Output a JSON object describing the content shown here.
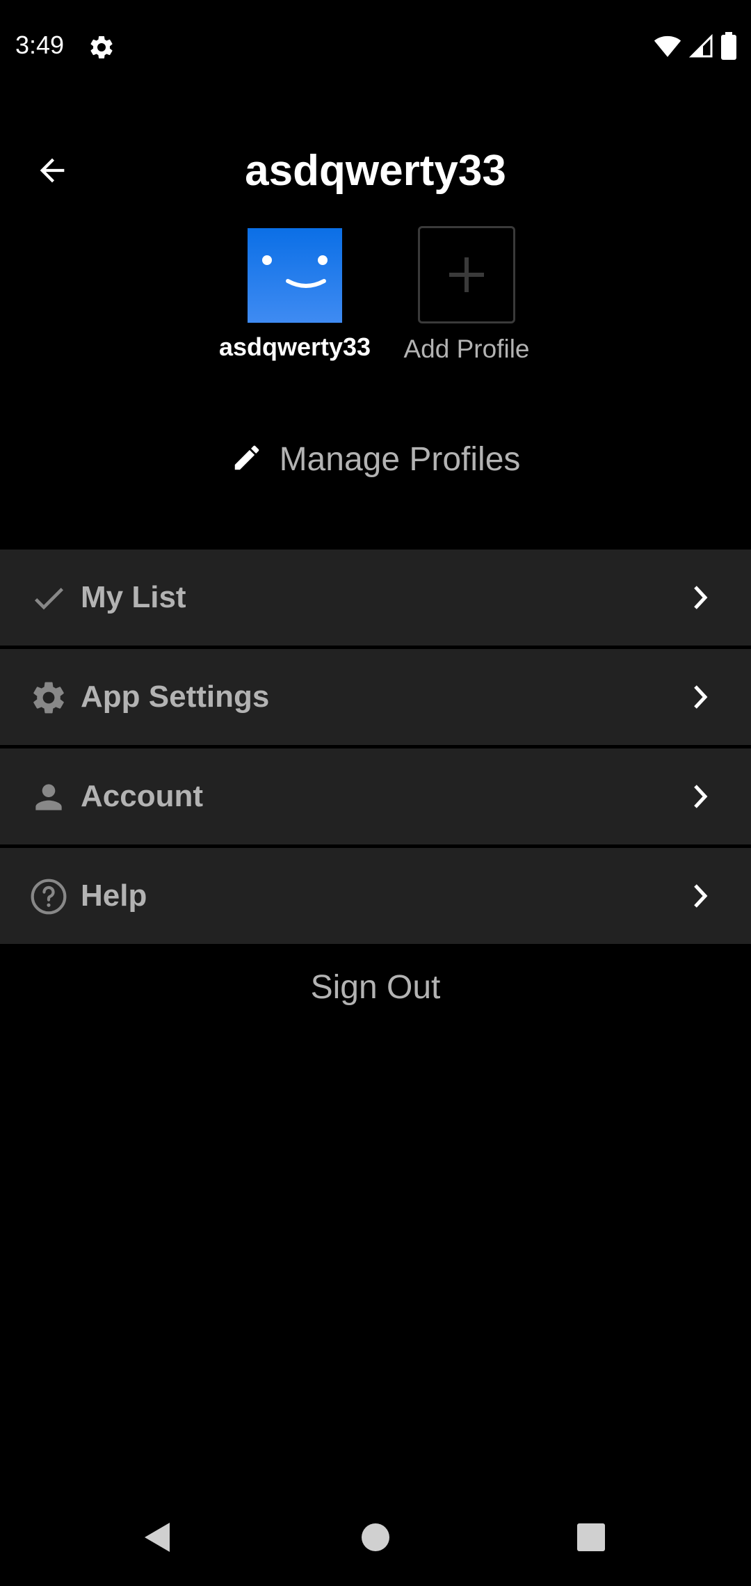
{
  "status_bar": {
    "time": "3:49",
    "settings_icon": "gear-icon",
    "wifi_icon": "wifi-icon",
    "signal_icon": "cell-signal-icon",
    "battery_icon": "battery-icon"
  },
  "header": {
    "title": "asdqwerty33",
    "back_icon": "arrow-left-icon"
  },
  "profiles": [
    {
      "name": "asdqwerty33",
      "avatar_color": "#1a73e8"
    }
  ],
  "add_profile": {
    "label": "Add Profile",
    "icon": "plus-icon"
  },
  "manage_profiles": {
    "label": "Manage Profiles",
    "icon": "pencil-icon"
  },
  "menu": {
    "items": [
      {
        "label": "My List",
        "icon": "check-icon"
      },
      {
        "label": "App Settings",
        "icon": "gear-icon"
      },
      {
        "label": "Account",
        "icon": "person-icon"
      },
      {
        "label": "Help",
        "icon": "help-circle-icon"
      }
    ]
  },
  "sign_out": {
    "label": "Sign Out"
  },
  "colors": {
    "background": "#000000",
    "row_background": "#222222",
    "muted_text": "#b3b3b3",
    "avatar_blue": "#1a73e8"
  }
}
